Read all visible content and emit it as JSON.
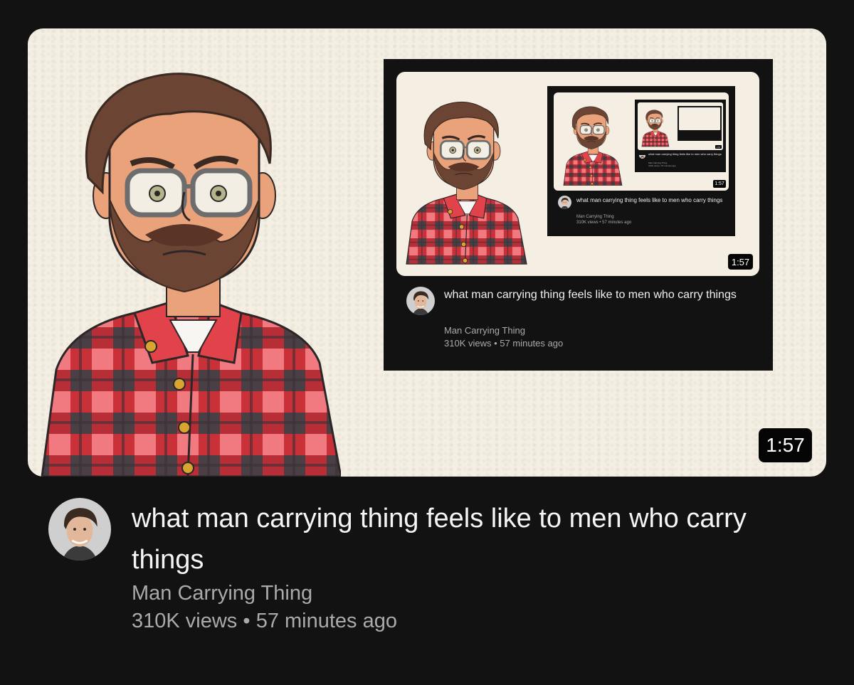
{
  "video": {
    "title": "what man carrying thing feels like to men who carry things",
    "channel": "Man Carrying Thing",
    "views": "310K views",
    "separator": "•",
    "age": "57 minutes ago",
    "duration": "1:57"
  },
  "icons": {
    "avatar": "channel-avatar-icon"
  },
  "colors": {
    "page_background": "#121212",
    "thumbnail_paper": "#f4efe2",
    "shirt_red": "#d8373f",
    "secondary_text": "#aaaaaa"
  }
}
